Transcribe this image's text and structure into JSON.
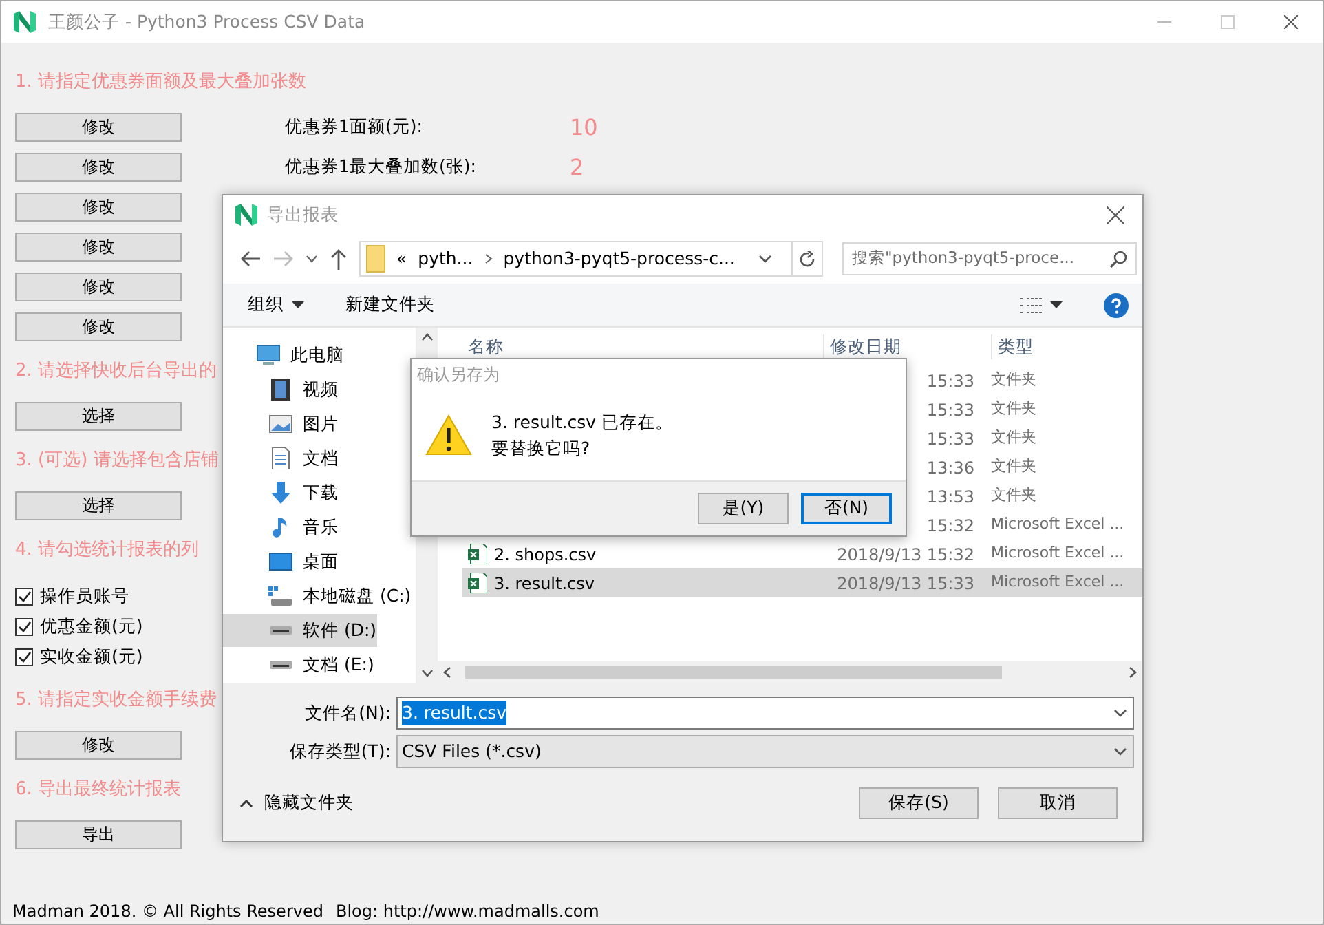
{
  "window": {
    "title": "王颜公子 - Python3 Process CSV Data"
  },
  "main": {
    "items": [
      {
        "kind": "heading",
        "text": "1. 请指定优惠券面额及最大叠加张数"
      },
      {
        "kind": "button",
        "label": "修改",
        "setting": "优惠券1面额(元):",
        "value": "10"
      },
      {
        "kind": "button",
        "label": "修改",
        "setting": "优惠券1最大叠加数(张):",
        "value": "2"
      },
      {
        "kind": "button",
        "label": "修改"
      },
      {
        "kind": "button",
        "label": "修改"
      },
      {
        "kind": "button",
        "label": "修改"
      },
      {
        "kind": "button",
        "label": "修改"
      },
      {
        "kind": "heading",
        "text": "2. 请选择快收后台导出的"
      },
      {
        "kind": "button",
        "label": "选择"
      },
      {
        "kind": "heading",
        "text": "3. (可选) 请选择包含店铺"
      },
      {
        "kind": "button",
        "label": "选择"
      },
      {
        "kind": "heading",
        "text": "4. 请勾选统计报表的列"
      },
      {
        "kind": "checkbox",
        "label": "操作员账号",
        "checked": true
      },
      {
        "kind": "checkbox",
        "label": "优惠金额(元)",
        "checked": true
      },
      {
        "kind": "checkbox",
        "label": "实收金额(元)",
        "checked": true
      },
      {
        "kind": "heading",
        "text": "5. 请指定实收金额手续费"
      },
      {
        "kind": "button",
        "label": "修改"
      },
      {
        "kind": "heading",
        "text": "6. 导出最终统计报表"
      },
      {
        "kind": "button",
        "label": "导出"
      }
    ]
  },
  "footer": {
    "copyright": "Madman 2018. © All Rights Reserved",
    "blog": "Blog: http://www.madmalls.com"
  },
  "save_dialog": {
    "title": "导出报表",
    "address": {
      "overflow": "«",
      "segments": [
        "pyth...",
        "python3-pyqt5-process-c..."
      ]
    },
    "search": {
      "placeholder": "搜索\"python3-pyqt5-proce..."
    },
    "toolbar": {
      "organize": "组织",
      "new_folder": "新建文件夹"
    },
    "sidebar": {
      "items": [
        {
          "label": "此电脑",
          "kind": "pc",
          "selected": false,
          "children": [
            {
              "label": "视频",
              "kind": "video",
              "selected": false
            },
            {
              "label": "图片",
              "kind": "pictures",
              "selected": false
            },
            {
              "label": "文档",
              "kind": "documents",
              "selected": false
            },
            {
              "label": "下载",
              "kind": "downloads",
              "selected": false
            },
            {
              "label": "音乐",
              "kind": "music",
              "selected": false
            },
            {
              "label": "桌面",
              "kind": "desktop",
              "selected": false
            },
            {
              "label": "本地磁盘 (C:)",
              "kind": "system-drive",
              "selected": false
            },
            {
              "label": "软件 (D:)",
              "kind": "drive",
              "selected": true
            },
            {
              "label": "文档 (E:)",
              "kind": "drive",
              "selected": false
            }
          ]
        }
      ]
    },
    "file_list": {
      "columns": [
        "名称",
        "修改日期",
        "类型"
      ],
      "rows": [
        {
          "modified": "15:33",
          "type": "文件夹",
          "selected": false
        },
        {
          "modified": "15:33",
          "type": "文件夹",
          "selected": false
        },
        {
          "modified": "15:33",
          "type": "文件夹",
          "selected": false
        },
        {
          "modified": "13:36",
          "type": "文件夹",
          "selected": false
        },
        {
          "modified": "13:53",
          "type": "文件夹",
          "selected": false
        },
        {
          "modified": "15:32",
          "type": "Microsoft Excel ...",
          "selected": false
        },
        {
          "kind": "excel",
          "name": "2. shops.csv",
          "modified": "2018/9/13 15:32",
          "type": "Microsoft Excel ...",
          "selected": false
        },
        {
          "kind": "excel",
          "name": "3. result.csv",
          "modified": "2018/9/13 15:33",
          "type": "Microsoft Excel ...",
          "selected": true
        }
      ]
    },
    "filename": {
      "label": "文件名(N):",
      "value": "3. result.csv"
    },
    "file_type": {
      "label": "保存类型(T):",
      "value": "CSV Files (*.csv)"
    },
    "hide_folders": "隐藏文件夹",
    "buttons": [
      "保存(S)",
      "取消"
    ]
  },
  "confirm_dialog": {
    "title": "确认另存为",
    "lines": [
      "3. result.csv 已存在。",
      "要替换它吗?"
    ],
    "buttons": [
      {
        "label": "是(Y)",
        "focused": false
      },
      {
        "label": "否(N)",
        "focused": true
      }
    ]
  }
}
